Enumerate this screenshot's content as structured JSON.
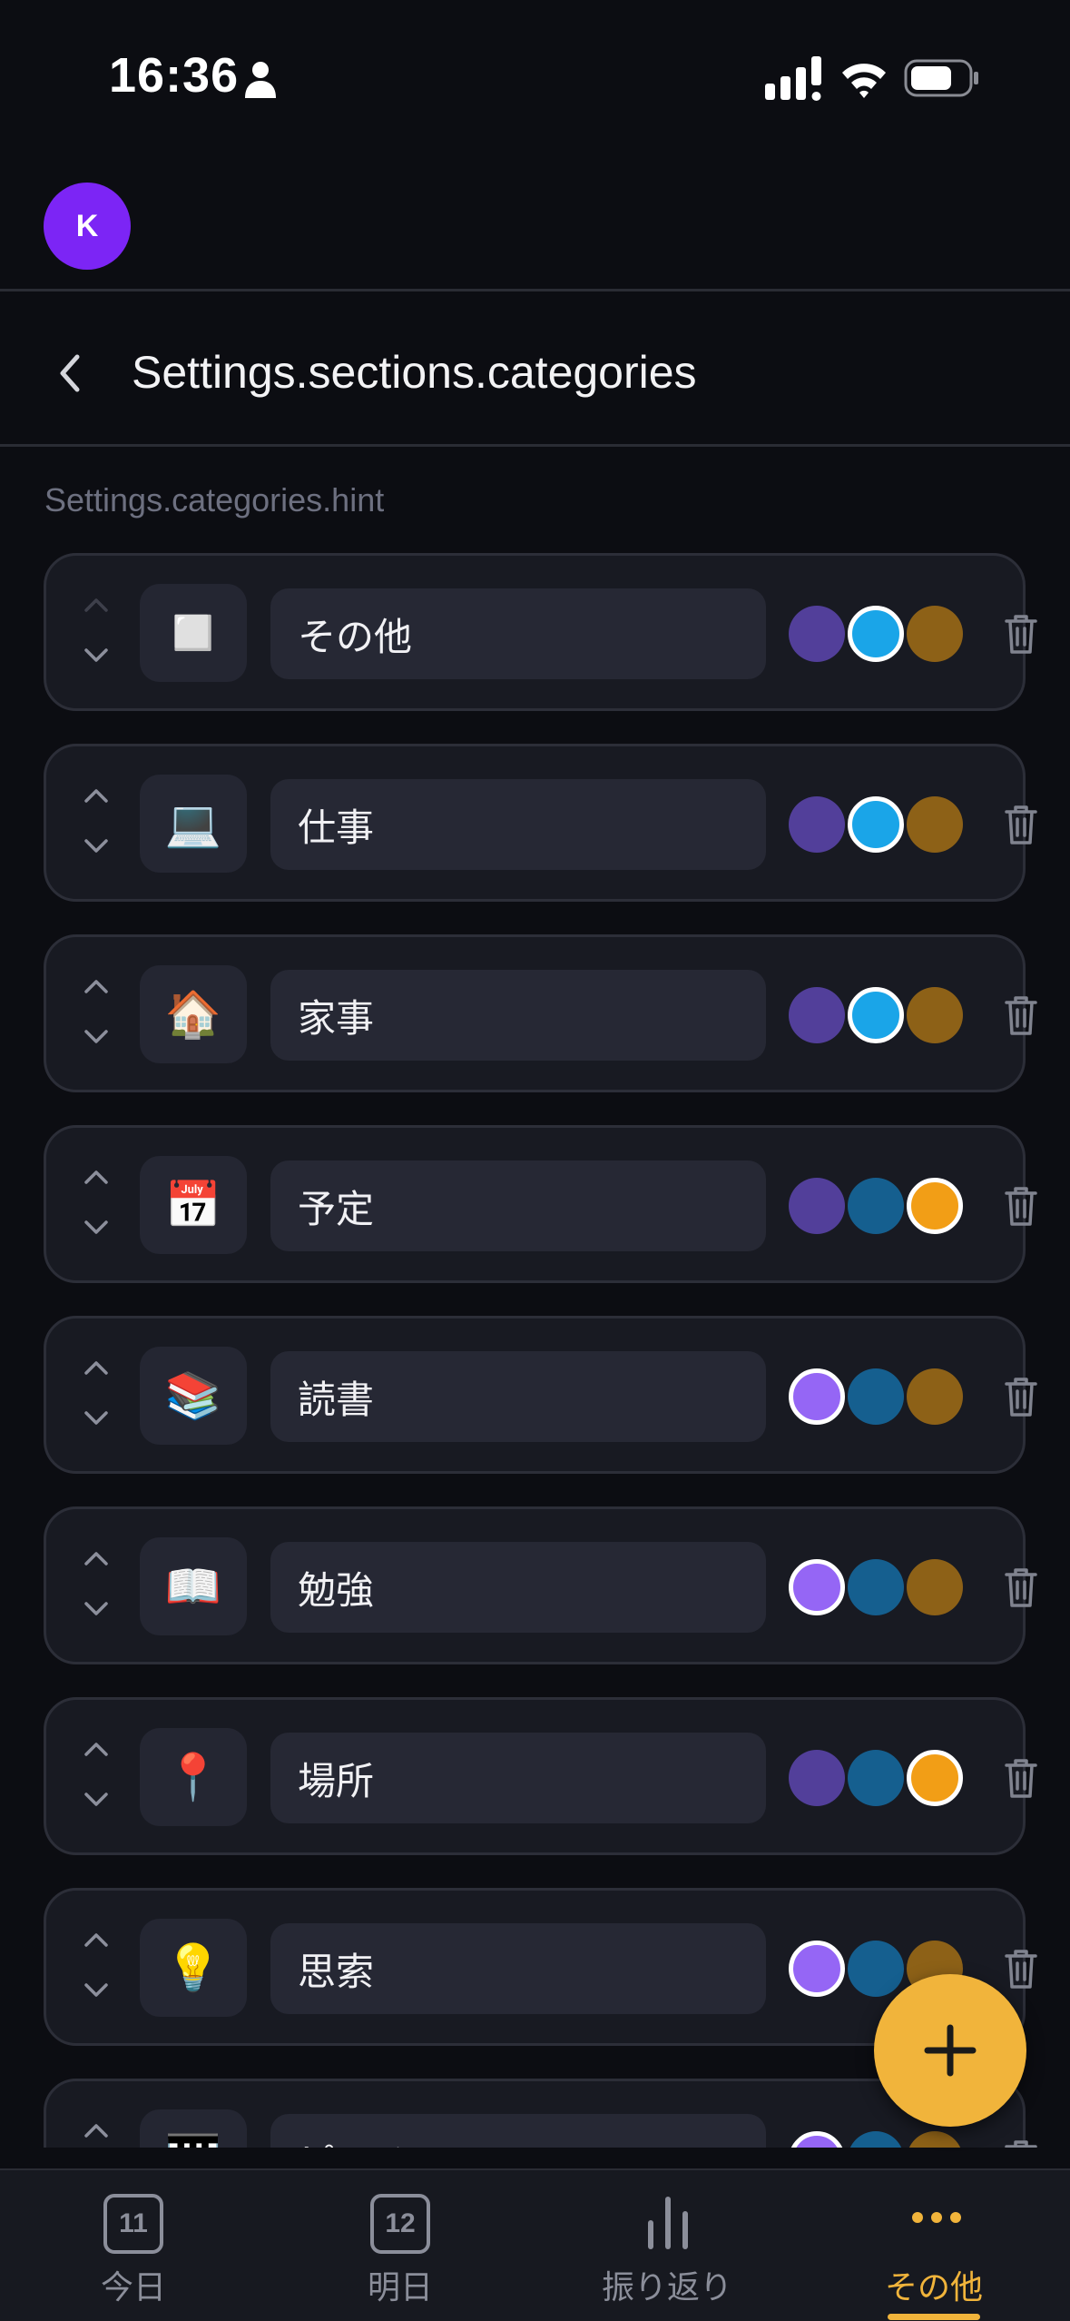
{
  "status_bar": {
    "time": "16:36"
  },
  "account": {
    "avatar_initial": "K"
  },
  "header": {
    "title": "Settings.sections.categories"
  },
  "hint": "Settings.categories.hint",
  "palette": [
    "#523f9a",
    "#1aa5e8",
    "#8d6117",
    "#155f8f",
    "#f29e16",
    "#9566f5"
  ],
  "categories": [
    {
      "icon": "◻️",
      "icon_name": "white-square-icon",
      "name": "その他",
      "swatches": [
        "#523f9a",
        "#1aa5e8",
        "#8d6117"
      ],
      "selected": 1,
      "can_move_up": false
    },
    {
      "icon": "💻",
      "icon_name": "laptop-icon",
      "name": "仕事",
      "swatches": [
        "#523f9a",
        "#1aa5e8",
        "#8d6117"
      ],
      "selected": 1,
      "can_move_up": true
    },
    {
      "icon": "🏠",
      "icon_name": "house-icon",
      "name": "家事",
      "swatches": [
        "#523f9a",
        "#1aa5e8",
        "#8d6117"
      ],
      "selected": 1,
      "can_move_up": true
    },
    {
      "icon": "📅",
      "icon_name": "calendar-icon",
      "name": "予定",
      "swatches": [
        "#523f9a",
        "#155f8f",
        "#f29e16"
      ],
      "selected": 2,
      "can_move_up": true
    },
    {
      "icon": "📚",
      "icon_name": "books-icon",
      "name": "読書",
      "swatches": [
        "#9566f5",
        "#155f8f",
        "#8d6117"
      ],
      "selected": 0,
      "can_move_up": true
    },
    {
      "icon": "📖",
      "icon_name": "open-book-icon",
      "name": "勉強",
      "swatches": [
        "#9566f5",
        "#155f8f",
        "#8d6117"
      ],
      "selected": 0,
      "can_move_up": true
    },
    {
      "icon": "📍",
      "icon_name": "pin-icon",
      "name": "場所",
      "swatches": [
        "#523f9a",
        "#155f8f",
        "#f29e16"
      ],
      "selected": 2,
      "can_move_up": true
    },
    {
      "icon": "💡",
      "icon_name": "light-bulb-icon",
      "name": "思索",
      "swatches": [
        "#9566f5",
        "#155f8f",
        "#8d6117"
      ],
      "selected": 0,
      "can_move_up": true
    },
    {
      "icon": "🎹",
      "icon_name": "piano-icon",
      "name": "ピアノ",
      "swatches": [
        "#9566f5",
        "#155f8f",
        "#8d6117"
      ],
      "selected": 0,
      "can_move_up": true
    }
  ],
  "tabs": [
    {
      "label": "今日",
      "day": "11",
      "active": false
    },
    {
      "label": "明日",
      "day": "12",
      "active": false
    },
    {
      "label": "振り返り",
      "active": false
    },
    {
      "label": "その他",
      "active": true
    }
  ],
  "colors": {
    "accent": "#f1b43b",
    "avatar": "#7c25f5",
    "background": "#0c0d12",
    "card": "#181a22"
  }
}
